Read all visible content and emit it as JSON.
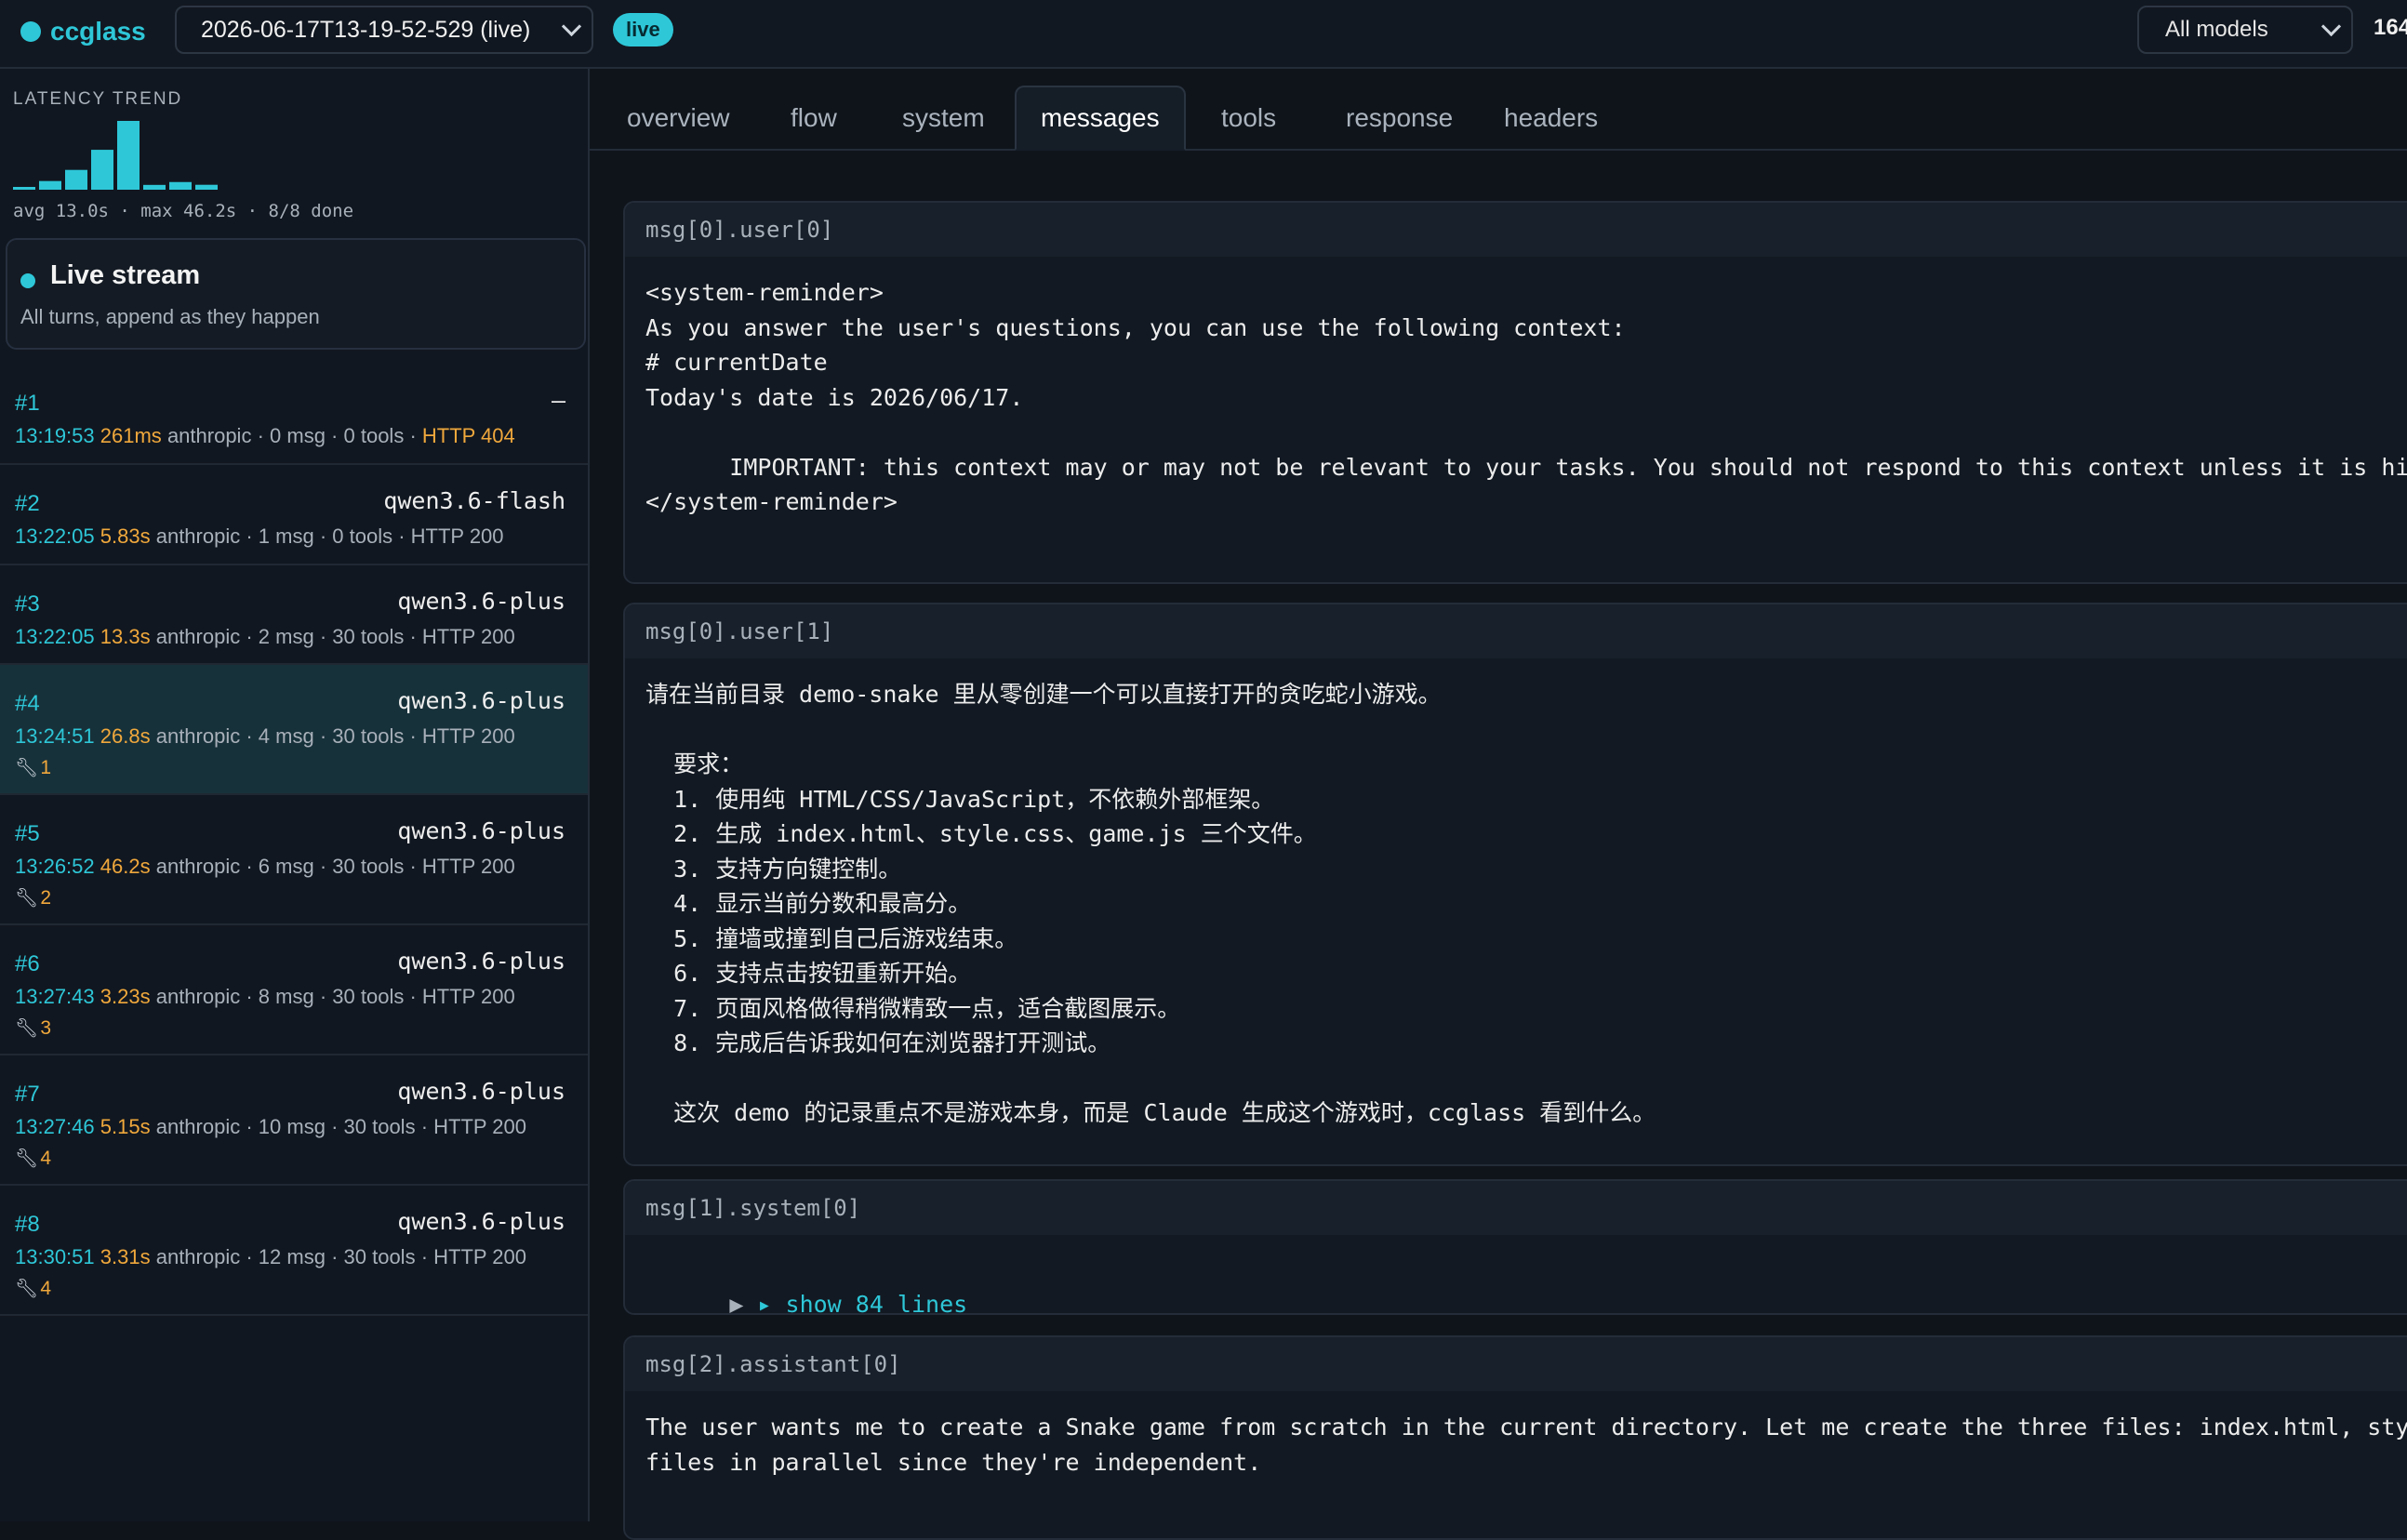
{
  "topbar": {
    "brand": "ccglass",
    "session": "2026-06-17T13-19-52-529 (live)",
    "live_badge": "live",
    "model_filter": "All models",
    "right_count": "164"
  },
  "sidebar": {
    "trend": {
      "title": "LATENCY TREND",
      "stats": "avg 13.0s · max 46.2s · 8/8 done",
      "latencies_s": [
        0.261,
        5.83,
        13.3,
        26.8,
        46.2,
        3.23,
        5.15,
        3.31
      ],
      "max_s": 46.2
    },
    "live": {
      "title": "Live stream",
      "subtitle": "All turns, append as they happen"
    },
    "turns": [
      {
        "id": "#1",
        "model": "–",
        "time": "13:19:53",
        "latency": "261ms",
        "provider": "anthropic",
        "msgs": "0 msg",
        "tools": "0 tools",
        "http": "HTTP 404",
        "tool_calls": ""
      },
      {
        "id": "#2",
        "model": "qwen3.6-flash",
        "time": "13:22:05",
        "latency": "5.83s",
        "provider": "anthropic",
        "msgs": "1 msg",
        "tools": "0 tools",
        "http": "HTTP 200",
        "tool_calls": ""
      },
      {
        "id": "#3",
        "model": "qwen3.6-plus",
        "time": "13:22:05",
        "latency": "13.3s",
        "provider": "anthropic",
        "msgs": "2 msg",
        "tools": "30 tools",
        "http": "HTTP 200",
        "tool_calls": ""
      },
      {
        "id": "#4",
        "model": "qwen3.6-plus",
        "time": "13:24:51",
        "latency": "26.8s",
        "provider": "anthropic",
        "msgs": "4 msg",
        "tools": "30 tools",
        "http": "HTTP 200",
        "tool_calls": "1"
      },
      {
        "id": "#5",
        "model": "qwen3.6-plus",
        "time": "13:26:52",
        "latency": "46.2s",
        "provider": "anthropic",
        "msgs": "6 msg",
        "tools": "30 tools",
        "http": "HTTP 200",
        "tool_calls": "2"
      },
      {
        "id": "#6",
        "model": "qwen3.6-plus",
        "time": "13:27:43",
        "latency": "3.23s",
        "provider": "anthropic",
        "msgs": "8 msg",
        "tools": "30 tools",
        "http": "HTTP 200",
        "tool_calls": "3"
      },
      {
        "id": "#7",
        "model": "qwen3.6-plus",
        "time": "13:27:46",
        "latency": "5.15s",
        "provider": "anthropic",
        "msgs": "10 msg",
        "tools": "30 tools",
        "http": "HTTP 200",
        "tool_calls": "4"
      },
      {
        "id": "#8",
        "model": "qwen3.6-plus",
        "time": "13:30:51",
        "latency": "3.31s",
        "provider": "anthropic",
        "msgs": "12 msg",
        "tools": "30 tools",
        "http": "HTTP 200",
        "tool_calls": "4"
      }
    ]
  },
  "main": {
    "tabs": [
      "overview",
      "flow",
      "system",
      "messages",
      "tools",
      "response",
      "headers"
    ],
    "active_tab": "messages",
    "messages": [
      {
        "label": "msg[0].user[0]",
        "body": "<system-reminder>\nAs you answer the user's questions, you can use the following context:\n# currentDate\nToday's date is 2026/06/17.\n\n      IMPORTANT: this context may or may not be relevant to your tasks. You should not respond to this context unless it is hi\n</system-reminder>"
      },
      {
        "label": "msg[0].user[1]",
        "body": "请在当前目录 demo-snake 里从零创建一个可以直接打开的贪吃蛇小游戏。\n\n  要求：\n  1. 使用纯 HTML/CSS/JavaScript，不依赖外部框架。\n  2. 生成 index.html、style.css、game.js 三个文件。\n  3. 支持方向键控制。\n  4. 显示当前分数和最高分。\n  5. 撞墙或撞到自己后游戏结束。\n  6. 支持点击按钮重新开始。\n  7. 页面风格做得稍微精致一点，适合截图展示。\n  8. 完成后告诉我如何在浏览器打开测试。\n\n  这次 demo 的记录重点不是游戏本身，而是 Claude 生成这个游戏时，ccglass 看到什么。"
      },
      {
        "label": "msg[1].system[0]",
        "toggle": "▸ show 84 lines"
      },
      {
        "label": "msg[2].assistant[0]",
        "body": "The user wants me to create a Snake game from scratch in the current directory. Let me create the three files: index.html, sty\nfiles in parallel since they're independent."
      }
    ]
  },
  "colors": {
    "accent": "#2ec7d8",
    "latency": "#f0a83c",
    "background": "#0f141b",
    "panel": "#111720",
    "selected_row": "#17313a"
  }
}
